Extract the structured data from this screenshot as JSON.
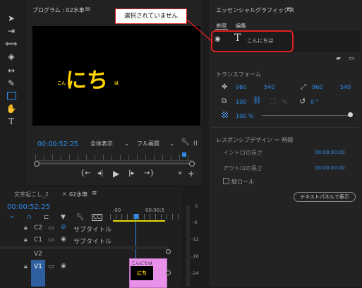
{
  "callout": {
    "text": "選択されていません",
    "border": "#e02020"
  },
  "program": {
    "title": "プログラム : 02水車",
    "menu": "≡",
    "timecode": "00:00:52:25",
    "view_label": "全体表示",
    "quality_label": "フル画質"
  },
  "video": {
    "main_text": "にち",
    "left_small": "こん",
    "right_small": "は",
    "text_color": "#ffd400"
  },
  "essential": {
    "title": "エッセンシャルグラフィックス",
    "menu": "≡",
    "tab_browse": "参照",
    "tab_edit": "編集",
    "layer_name": "こんにちは",
    "transform_title": "トランスフォーム",
    "pos_x": "960",
    "pos_y": "540",
    "anchor_x": "960",
    "anchor_y": "540",
    "scale": "100",
    "rotation": "0 °",
    "opacity_label": "100 %",
    "pct_sign": "%",
    "responsive_title": "レスポンシブデザイン ー 時間",
    "intro_label": "イントロの長さ",
    "intro_value": "00:00:00:00",
    "outro_label": "アウトロの長さ",
    "outro_value": "00:00:00:00",
    "roll_label": "縦ロール",
    "text_panel_btn": "テキストパネルで表示"
  },
  "timeline": {
    "tab1": "文字起こし_2",
    "tab2": "02水車",
    "tab2_menu": "≡",
    "timecode": "00:00:52:25",
    "ruler": [
      ":00",
      "00:00:5"
    ],
    "tracks": [
      {
        "name": "C2",
        "label": "サブタイトル"
      },
      {
        "name": "C1",
        "label": "サブタイトル"
      },
      {
        "name": "V2",
        "label": ""
      },
      {
        "name": "V1",
        "label": ""
      }
    ],
    "clip_title": "こんにちは",
    "clip_thumb": "にち"
  },
  "meter": {
    "labels": [
      "0",
      "-6",
      "-12",
      "-18",
      "-24"
    ]
  }
}
